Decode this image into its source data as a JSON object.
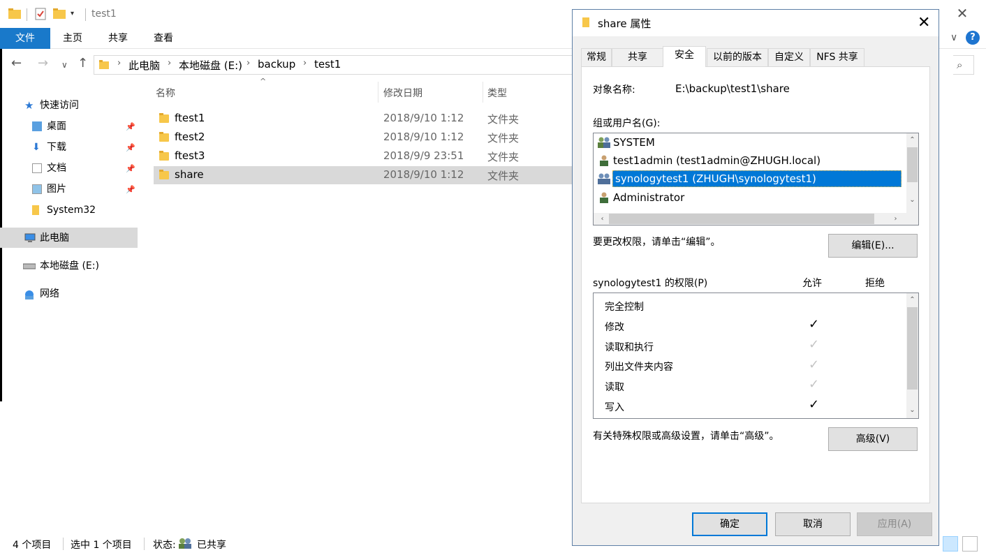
{
  "explorer": {
    "window_title": "test1",
    "ribbon_tabs": [
      "文件",
      "主页",
      "共享",
      "查看"
    ],
    "breadcrumb": [
      "此电脑",
      "本地磁盘 (E:)",
      "backup",
      "test1"
    ],
    "sidebar": {
      "quick_access": "快速访问",
      "pinned": [
        "桌面",
        "下载",
        "文档",
        "图片"
      ],
      "system32": "System32",
      "this_pc": "此电脑",
      "local_disk": "本地磁盘 (E:)",
      "network": "网络"
    },
    "columns": {
      "name": "名称",
      "date": "修改日期",
      "type": "类型"
    },
    "files": [
      {
        "name": "ftest1",
        "date": "2018/9/10 1:12",
        "type": "文件夹"
      },
      {
        "name": "ftest2",
        "date": "2018/9/10 1:12",
        "type": "文件夹"
      },
      {
        "name": "ftest3",
        "date": "2018/9/9 23:51",
        "type": "文件夹"
      },
      {
        "name": "share",
        "date": "2018/9/10 1:12",
        "type": "文件夹"
      }
    ],
    "status": {
      "count": "4 个项目",
      "selected": "选中 1 个项目",
      "state_label": "状态:",
      "state_value": "已共享"
    }
  },
  "dialog": {
    "title": "share 属性",
    "tabs": [
      "常规",
      "共享",
      "安全",
      "以前的版本",
      "自定义",
      "NFS 共享"
    ],
    "active_tab": "安全",
    "object_label": "对象名称:",
    "object_value": "E:\\backup\\test1\\share",
    "groups_label": "组或用户名(G):",
    "users": [
      "SYSTEM",
      "test1admin (test1admin@ZHUGH.local)",
      "synologytest1 (ZHUGH\\synologytest1)",
      "Administrator"
    ],
    "selected_user": "synologytest1 (ZHUGH\\synologytest1)",
    "edit_hint": "要更改权限，请单击“编辑”。",
    "edit_button": "编辑(E)...",
    "perm_label": "synologytest1 的权限(P)",
    "allow_label": "允许",
    "deny_label": "拒绝",
    "permissions": [
      {
        "name": "完全控制",
        "allow": "none"
      },
      {
        "name": "修改",
        "allow": "explicit"
      },
      {
        "name": "读取和执行",
        "allow": "inherited"
      },
      {
        "name": "列出文件夹内容",
        "allow": "inherited"
      },
      {
        "name": "读取",
        "allow": "inherited"
      },
      {
        "name": "写入",
        "allow": "explicit"
      }
    ],
    "advanced_hint": "有关特殊权限或高级设置，请单击“高级”。",
    "advanced_button": "高级(V)",
    "ok_button": "确定",
    "cancel_button": "取消",
    "apply_button": "应用(A)"
  },
  "colors": {
    "accent": "#0078d7",
    "file_tab": "#1979ca",
    "folder": "#f7c74a",
    "selection_gray": "#d9d9d9"
  }
}
